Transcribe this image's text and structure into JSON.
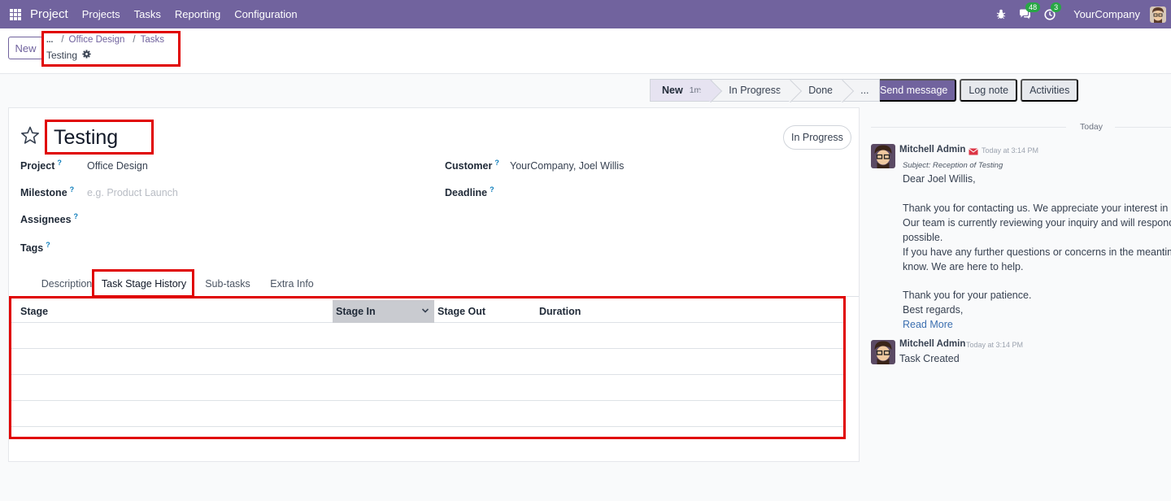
{
  "navbar": {
    "brand": "Project",
    "menu": [
      "Projects",
      "Tasks",
      "Reporting",
      "Configuration"
    ],
    "messages_count": "48",
    "activities_count": "3",
    "company": "YourCompany"
  },
  "control": {
    "new_label": "New",
    "breadcrumb": [
      "...",
      "Office Design",
      "Tasks"
    ],
    "current": "Testing"
  },
  "statusbar": {
    "stages": [
      {
        "label": "New",
        "duration": "1m"
      },
      {
        "label": "In Progress"
      },
      {
        "label": "Done"
      },
      {
        "label": "..."
      }
    ]
  },
  "chatter_buttons": [
    "Send message",
    "Log note",
    "Activities"
  ],
  "form": {
    "title": "Testing",
    "status": "In Progress",
    "project_label": "Project",
    "project_value": "Office Design",
    "milestone_label": "Milestone",
    "milestone_placeholder": "e.g. Product Launch",
    "assignees_label": "Assignees",
    "tags_label": "Tags",
    "customer_label": "Customer",
    "customer_value": "YourCompany, Joel Willis",
    "deadline_label": "Deadline",
    "help_mark": "?"
  },
  "tabs": [
    "Description",
    "Task Stage History",
    "Sub-tasks",
    "Extra Info"
  ],
  "table": {
    "columns": [
      "Stage",
      "Stage In",
      "Stage Out",
      "Duration"
    ],
    "rows": []
  },
  "chatter": {
    "date_separator": "Today",
    "messages": [
      {
        "author": "Mitchell Admin",
        "time": "Today at 3:14 PM",
        "subject": "Subject: Reception of Testing",
        "lines": [
          "Dear Joel Willis,",
          "",
          "Thank you for contacting us. We appreciate your interest in ou",
          "Our team is currently reviewing your inquiry and will respond t",
          "possible.",
          "If you have any further questions or concerns in the meantime,",
          "know. We are here to help.",
          "",
          "Thank you for your patience.",
          "Best regards,"
        ],
        "read_more": "Read More"
      },
      {
        "author": "Mitchell Admin",
        "time": "Today at 3:14 PM",
        "body": "Task Created"
      }
    ]
  },
  "colors": {
    "brand": "#71639e",
    "highlight": "#e00000"
  }
}
